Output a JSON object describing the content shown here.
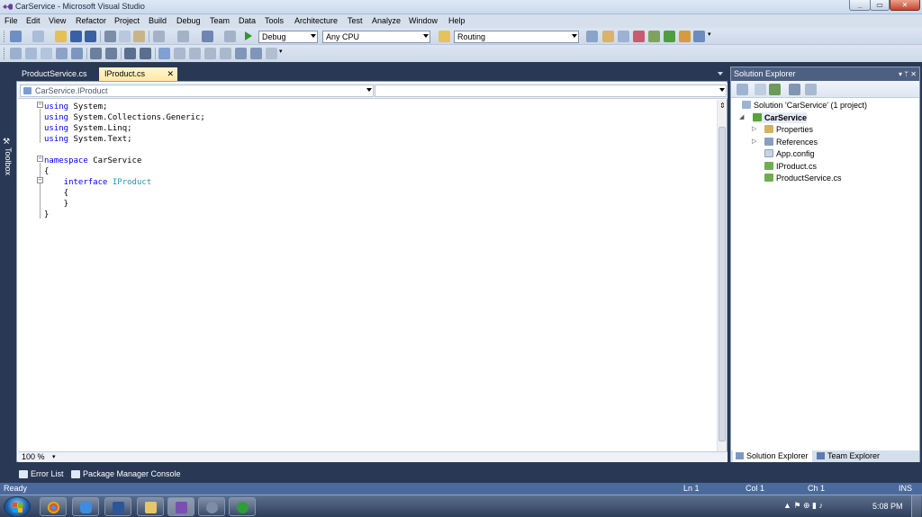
{
  "window": {
    "title": "CarService - Microsoft Visual Studio",
    "min_icon": "minimize-icon",
    "max_icon": "maximize-icon",
    "close_icon": "close-icon"
  },
  "menu": [
    "File",
    "Edit",
    "View",
    "Refactor",
    "Project",
    "Build",
    "Debug",
    "Team",
    "Data",
    "Tools",
    "Architecture",
    "Test",
    "Analyze",
    "Window",
    "Help"
  ],
  "toolbar": {
    "config": "Debug",
    "platform": "Any CPU",
    "find": "Routing"
  },
  "toolbox": {
    "label": "Toolbox"
  },
  "doc_tabs": [
    {
      "label": "ProductService.cs",
      "active": false
    },
    {
      "label": "IProduct.cs",
      "active": true
    }
  ],
  "editor": {
    "nav_type": "CarService.IProduct",
    "nav_member": "",
    "zoom": "100 %",
    "lines": [
      {
        "parts": [
          {
            "t": "using",
            "c": "kw"
          },
          {
            "t": " System;",
            "c": ""
          }
        ]
      },
      {
        "parts": [
          {
            "t": "using",
            "c": "kw"
          },
          {
            "t": " System.Collections.Generic;",
            "c": ""
          }
        ]
      },
      {
        "parts": [
          {
            "t": "using",
            "c": "kw"
          },
          {
            "t": " System.Linq;",
            "c": ""
          }
        ]
      },
      {
        "parts": [
          {
            "t": "using",
            "c": "kw"
          },
          {
            "t": " System.Text;",
            "c": ""
          }
        ]
      },
      {
        "parts": []
      },
      {
        "parts": [
          {
            "t": "namespace",
            "c": "kw"
          },
          {
            "t": " CarService",
            "c": ""
          }
        ]
      },
      {
        "parts": [
          {
            "t": "{",
            "c": ""
          }
        ]
      },
      {
        "parts": [
          {
            "t": "    interface",
            "c": "kw"
          },
          {
            "t": " ",
            "c": ""
          },
          {
            "t": "IProduct",
            "c": "typ"
          }
        ]
      },
      {
        "parts": [
          {
            "t": "    {",
            "c": ""
          }
        ]
      },
      {
        "parts": [
          {
            "t": "    }",
            "c": ""
          }
        ]
      },
      {
        "parts": [
          {
            "t": "}",
            "c": ""
          }
        ]
      }
    ]
  },
  "solution_explorer": {
    "title": "Solution Explorer",
    "pin": "▾ ᛘ ✕",
    "items": [
      {
        "label": "Solution 'CarService' (1 project)",
        "icon": "solution-icon",
        "bold": false
      },
      {
        "label": "CarService",
        "icon": "csharp-project-icon",
        "bold": true
      },
      {
        "label": "Properties",
        "icon": "properties-icon",
        "bold": false
      },
      {
        "label": "References",
        "icon": "references-icon",
        "bold": false
      },
      {
        "label": "App.config",
        "icon": "config-file-icon",
        "bold": false
      },
      {
        "label": "IProduct.cs",
        "icon": "cs-file-icon",
        "bold": false
      },
      {
        "label": "ProductService.cs",
        "icon": "cs-file-icon",
        "bold": false
      }
    ],
    "tabs": [
      "Solution Explorer",
      "Team Explorer"
    ]
  },
  "bottom_tabs": [
    "Error List",
    "Package Manager Console"
  ],
  "status": {
    "ready": "Ready",
    "ln": "Ln 1",
    "col": "Col 1",
    "ch": "Ch 1",
    "ins": "INS"
  },
  "taskbar": {
    "clock": "5:08 PM",
    "tray": "▲ ⚑ ⊕ ▮ ♪"
  },
  "colors": {
    "chrome": "#293955",
    "active_tab": "#ffe8a6",
    "keyword": "#0000ff",
    "type": "#2b91af"
  }
}
